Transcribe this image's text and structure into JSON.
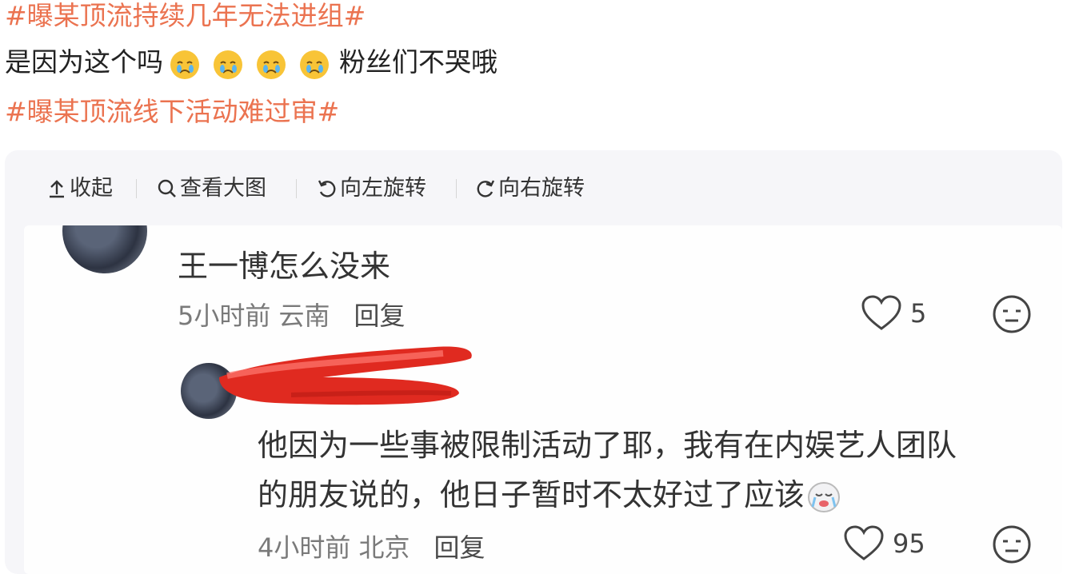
{
  "post": {
    "hashtag1": "#曝某顶流持续几年无法进组#",
    "text_before": "是因为这个吗",
    "emoji_names": [
      "crying-face-icon",
      "crying-face-icon",
      "crying-face-icon",
      "crying-face-icon"
    ],
    "text_after": "粉丝们不哭哦",
    "hashtag2": "#曝某顶流线下活动难过审#",
    "hashtag_color": "#eb7350"
  },
  "toolbar": {
    "collapse": "收起",
    "view_large": "查看大图",
    "rotate_left": "向左旋转",
    "rotate_right": "向右旋转"
  },
  "image": {
    "comment1": {
      "text": "王一博怎么没来",
      "meta": "5小时前 云南",
      "reply": "回复",
      "likes": "5"
    },
    "comment2": {
      "line1": "他因为一些事被限制活动了耶，我有在内娱艺人团队",
      "line2": "的朋友说的，他日子暂时不太好过了应该",
      "meta": "4小时前 北京",
      "reply": "回复",
      "likes": "95",
      "redaction_color": "#e02a20"
    }
  }
}
